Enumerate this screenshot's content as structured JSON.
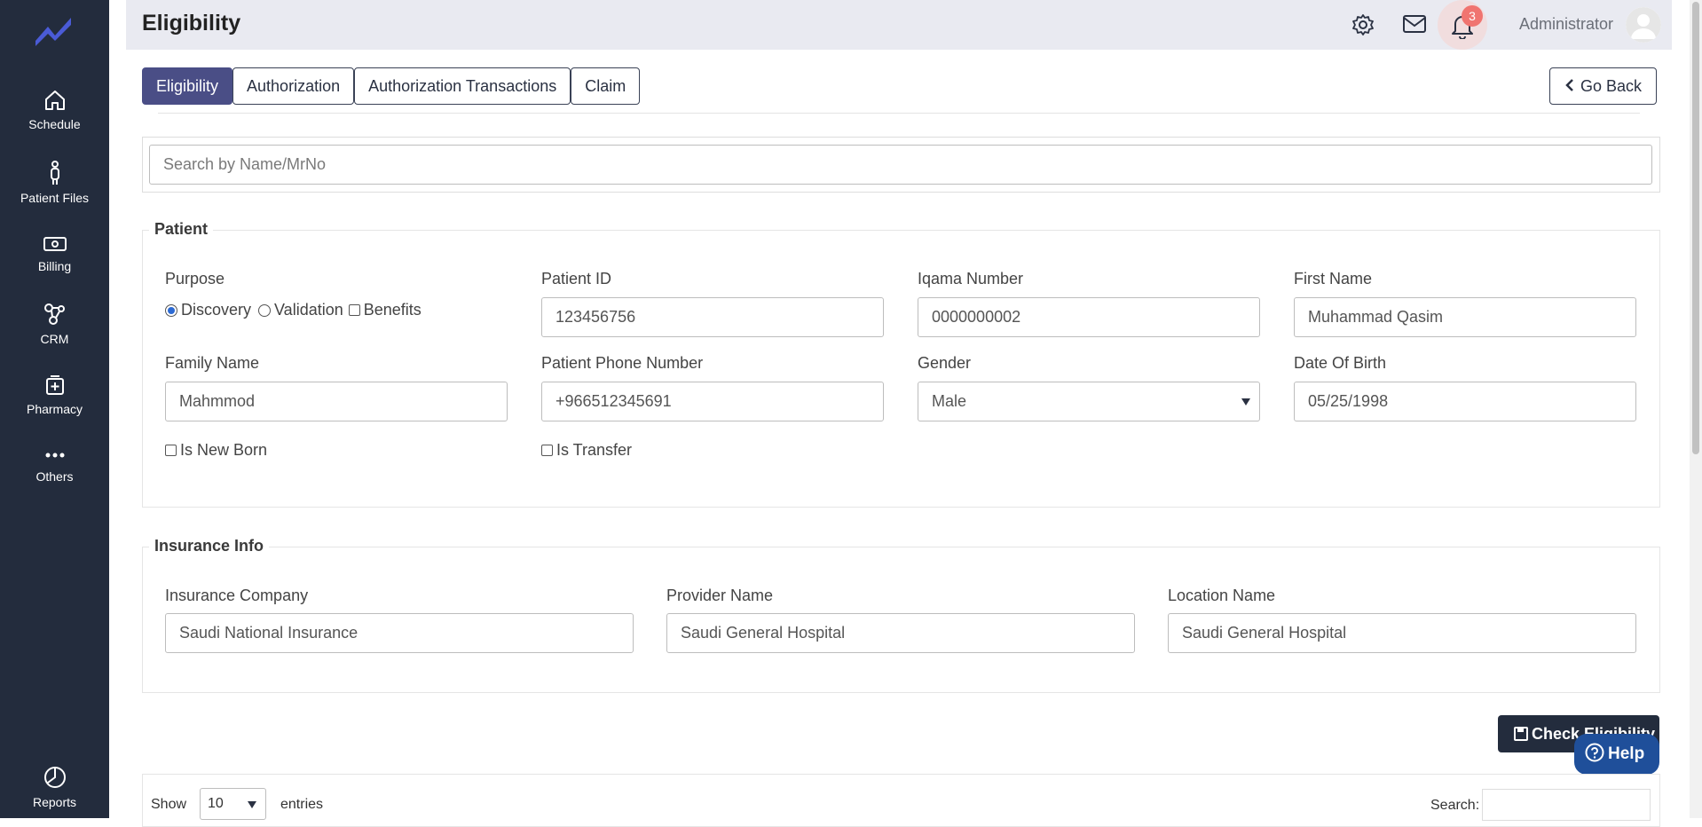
{
  "sidebar": {
    "items": [
      {
        "label": "Schedule",
        "icon": "home-icon"
      },
      {
        "label": "Patient Files",
        "icon": "person-icon"
      },
      {
        "label": "Billing",
        "icon": "money-icon"
      },
      {
        "label": "CRM",
        "icon": "network-icon"
      },
      {
        "label": "Pharmacy",
        "icon": "pharmacy-icon"
      },
      {
        "label": "Others",
        "icon": "more-icon"
      }
    ],
    "reports_label": "Reports"
  },
  "header": {
    "title": "Eligibility",
    "notifications_count": "3",
    "user": "Administrator"
  },
  "tabs": [
    {
      "label": "Eligibility",
      "active": true
    },
    {
      "label": "Authorization",
      "active": false
    },
    {
      "label": "Authorization Transactions",
      "active": false
    },
    {
      "label": "Claim",
      "active": false
    }
  ],
  "go_back_label": "Go Back",
  "search": {
    "placeholder": "Search by Name/MrNo"
  },
  "patient": {
    "legend": "Patient",
    "purpose_label": "Purpose",
    "purpose_options": {
      "discovery": "Discovery",
      "validation": "Validation",
      "benefits": "Benefits"
    },
    "patient_id_label": "Patient ID",
    "patient_id": "123456756",
    "iqama_label": "Iqama Number",
    "iqama": "0000000002",
    "first_name_label": "First Name",
    "first_name": "Muhammad Qasim",
    "family_name_label": "Family Name",
    "family_name": "Mahmmod",
    "phone_label": "Patient Phone Number",
    "phone": "+966512345691",
    "gender_label": "Gender",
    "gender": "Male",
    "dob_label": "Date Of Birth",
    "dob": "05/25/1998",
    "new_born_label": "Is New Born",
    "transfer_label": "Is Transfer"
  },
  "insurance": {
    "legend": "Insurance Info",
    "company_label": "Insurance Company",
    "company": "Saudi National Insurance",
    "provider_label": "Provider Name",
    "provider": "Saudi General Hospital",
    "location_label": "Location Name",
    "location": "Saudi General Hospital"
  },
  "check_button": "Check Eligibility",
  "help_button": "Help",
  "table": {
    "show_label": "Show",
    "entries_value": "10",
    "entries_label": "entries",
    "search_label": "Search:"
  }
}
